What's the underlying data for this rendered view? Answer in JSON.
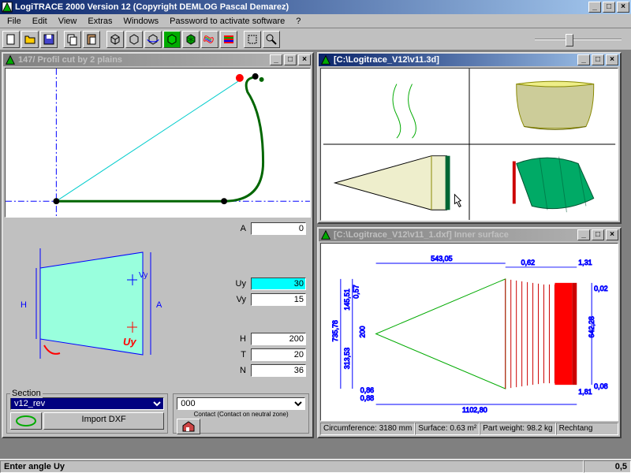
{
  "app": {
    "title": "LogiTRACE 2000  Version 12  (Copyright DEMLOG Pascal Demarez)"
  },
  "menu": {
    "file": "File",
    "edit": "Edit",
    "view": "View",
    "extras": "Extras",
    "windows": "Windows",
    "password": "Password to activate software",
    "help": "?"
  },
  "win1": {
    "title": "147/ Profil cut by 2 plains",
    "params": {
      "A_label": "A",
      "A": "0",
      "Uy_label": "Uy",
      "Uy": "30",
      "Vy_label": "Vy",
      "Vy": "15",
      "H_label": "H",
      "H": "200",
      "T_label": "T",
      "T": "20",
      "N_label": "N",
      "N": "36"
    },
    "diagram": {
      "H": "H",
      "A": "A",
      "Vy": "Vy",
      "Uy": "Uy"
    },
    "section_label": "Section",
    "section_value": "v12_rev",
    "import_btn": "Import DXF",
    "combo2": "000",
    "contact_label": "Contact (Contact on neutral zone)"
  },
  "win2": {
    "title": "[C:\\Logitrace_V12\\v11.3d]"
  },
  "win3": {
    "title": "[C:\\Logitrace_V12\\v11_1.dxf]  Inner surface",
    "dims": {
      "top1": "543,05",
      "top2": "0,62",
      "tr": "1,31",
      "r1": "0,02",
      "left1": "145,51",
      "left1b": "0,57",
      "left2": "735,78",
      "left2b": "200",
      "left3": "313,53",
      "bl1": "0,86",
      "bl2": "0,88",
      "right": "642,28",
      "br1": "1,81",
      "br2": "0,08",
      "bottom": "1102,80"
    },
    "info": {
      "circ_label": "Circumference:",
      "circ": "3180 mm",
      "surf_label": "Surface:",
      "surf": "0.63 m²",
      "weight_label": "Part weight:",
      "weight": "98.2 kg",
      "rect": "Rechtang"
    }
  },
  "status": {
    "hint": "Enter angle Uy",
    "value": "0,5"
  }
}
